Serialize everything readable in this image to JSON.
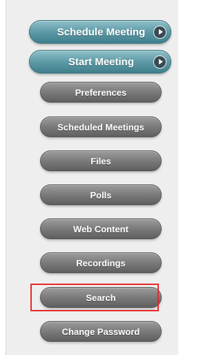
{
  "menu": {
    "primary": [
      {
        "label": "Schedule Meeting",
        "icon": "play-arrow-icon"
      },
      {
        "label": "Start Meeting",
        "icon": "play-arrow-icon"
      }
    ],
    "items": [
      {
        "label": "Preferences"
      },
      {
        "label": "Scheduled Meetings"
      },
      {
        "label": "Files"
      },
      {
        "label": "Polls"
      },
      {
        "label": "Web Content"
      },
      {
        "label": "Recordings"
      },
      {
        "label": "Search",
        "highlighted": true
      },
      {
        "label": "Change Password"
      }
    ]
  },
  "colors": {
    "primary_button": "#5e9aa6",
    "secondary_button": "#7a7a7a",
    "highlight_border": "#e8282a",
    "panel_background": "#eeeeee"
  }
}
